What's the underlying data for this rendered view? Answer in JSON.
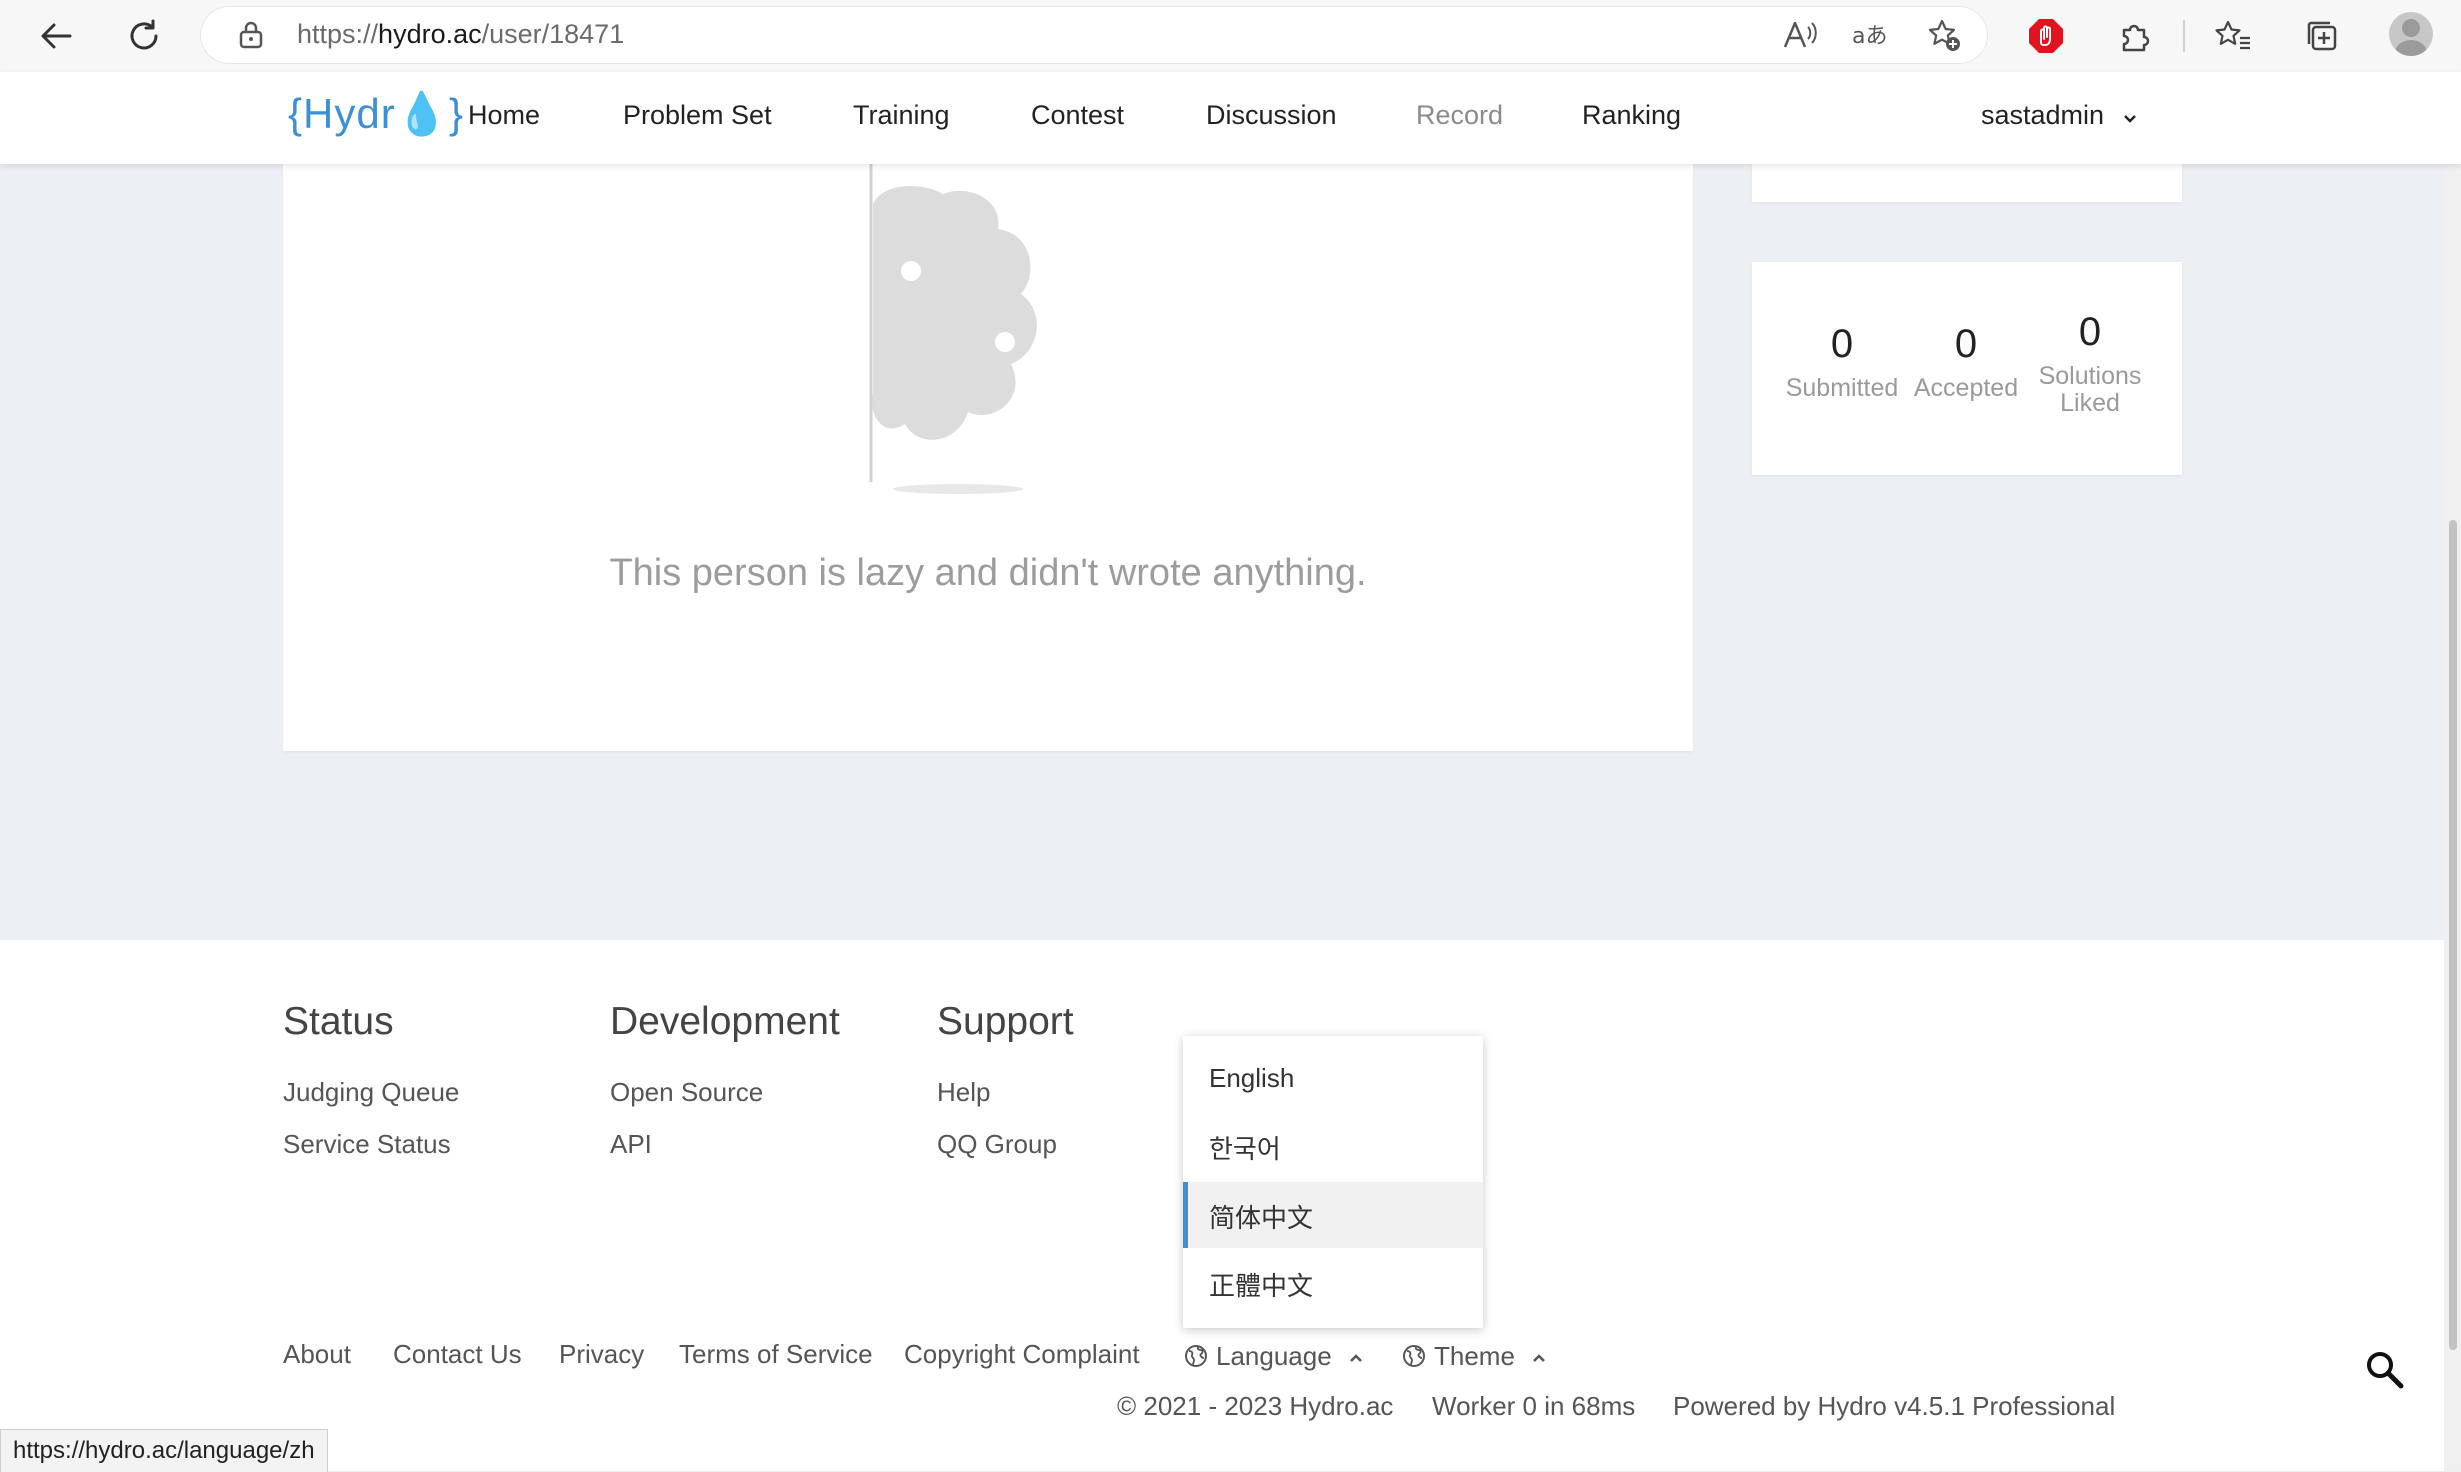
{
  "browser": {
    "url_prefix": "https://",
    "url_host": "hydro.ac",
    "url_path": "/user/18471",
    "status_url": "https://hydro.ac/language/zh"
  },
  "site": {
    "logo_text": "{Hydr",
    "logo_close": "}",
    "nav": {
      "home": "Home",
      "problem_set": "Problem Set",
      "training": "Training",
      "contest": "Contest",
      "discussion": "Discussion",
      "record": "Record",
      "ranking": "Ranking"
    },
    "username": "sastadmin"
  },
  "profile": {
    "empty_bio_text": "This person is lazy and didn't wrote anything.",
    "stats": {
      "submitted_value": "0",
      "submitted_label": "Submitted",
      "accepted_value": "0",
      "accepted_label": "Accepted",
      "liked_value": "0",
      "liked_label_1": "Solutions",
      "liked_label_2": "Liked"
    }
  },
  "footer": {
    "status": {
      "heading": "Status",
      "links": [
        "Judging Queue",
        "Service Status"
      ]
    },
    "development": {
      "heading": "Development",
      "links": [
        "Open Source",
        "API"
      ]
    },
    "support": {
      "heading": "Support",
      "links": [
        "Help",
        "QQ Group"
      ]
    },
    "bottom_links": {
      "about": "About",
      "contact": "Contact Us",
      "privacy": "Privacy",
      "terms": "Terms of Service",
      "copyright": "Copyright Complaint",
      "language": "Language",
      "theme": "Theme"
    },
    "copyright_text": "© 2021 - 2023 Hydro.ac",
    "worker_text": "Worker 0 in 68ms",
    "powered_text": "Powered by Hydro v4.5.1 Professional"
  },
  "language_menu": {
    "items": [
      "English",
      "한국어",
      "简体中文",
      "正體中文"
    ],
    "selected": "简体中文"
  },
  "colors": {
    "accent": "#3d8fd6",
    "page_background": "#eceff3",
    "adblock_red": "#e0141e"
  }
}
